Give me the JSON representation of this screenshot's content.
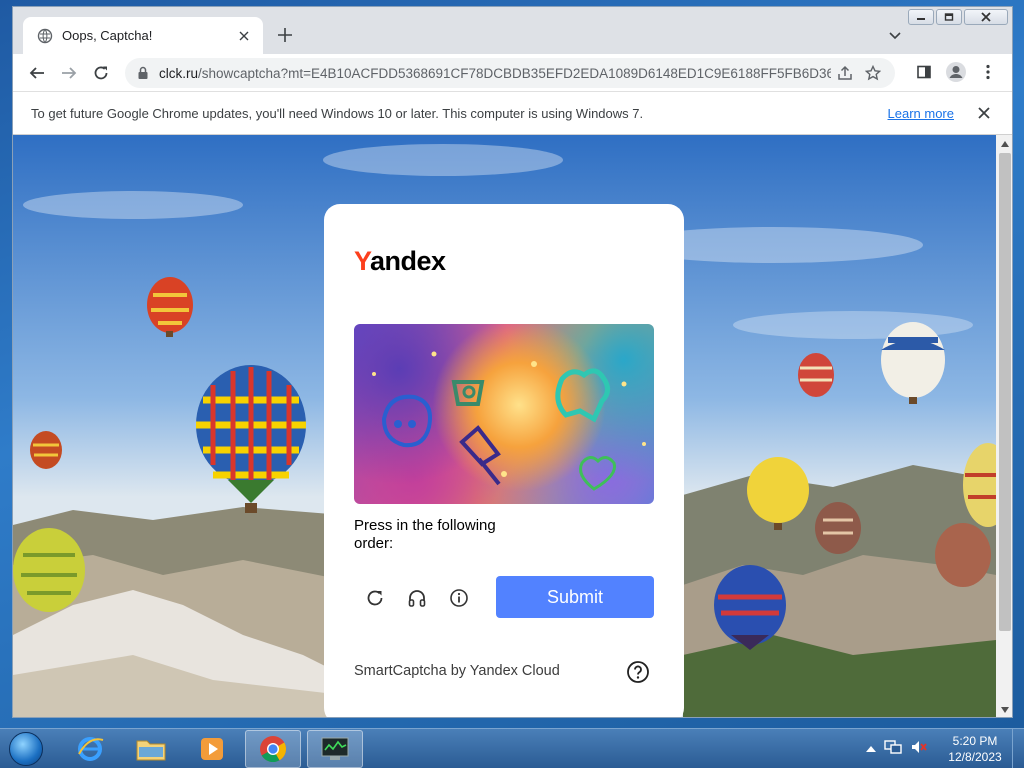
{
  "tab": {
    "title": "Oops, Captcha!"
  },
  "url": {
    "host": "clck.ru",
    "path": "/showcaptcha?mt=E4B10ACFDD5368691CF78DCBDB35EFD2EDA1089D6148ED1C9E6188FF5FB6D362..."
  },
  "infobar": {
    "message": "To get future Google Chrome updates, you'll need Windows 10 or later. This computer is using Windows 7.",
    "learn_more": "Learn more"
  },
  "captcha": {
    "logo_first": "Y",
    "logo_rest": "andex",
    "prompt": "Press in the following order:",
    "submit_label": "Submit",
    "footer": "SmartCaptcha by Yandex Cloud"
  },
  "taskbar": {
    "time": "5:20 PM",
    "date": "12/8/2023",
    "apps": [
      "internet-explorer",
      "file-explorer",
      "media-player",
      "chrome",
      "task-manager"
    ]
  },
  "colors": {
    "submit": "#5282ff",
    "yandex_red": "#fc3f1d",
    "link": "#1a73e8"
  }
}
